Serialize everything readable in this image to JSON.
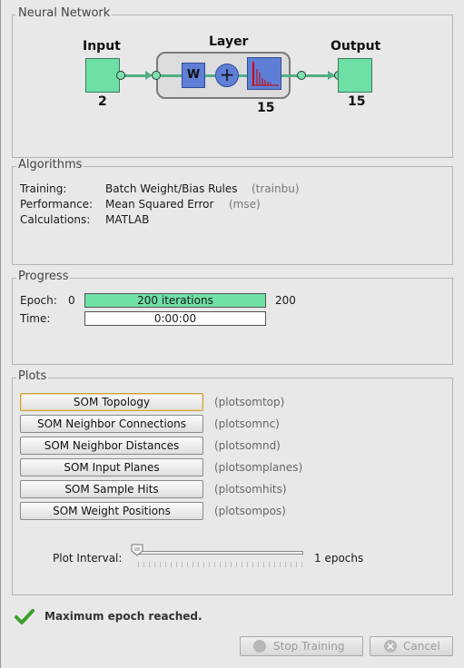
{
  "network": {
    "title": "Neural Network",
    "input_label": "Input",
    "input_size": "2",
    "layer_label": "Layer",
    "layer_size": "15",
    "weight_symbol": "W",
    "sum_symbol": "+",
    "output_label": "Output",
    "output_size": "15"
  },
  "algorithms": {
    "title": "Algorithms",
    "rows": [
      {
        "label": "Training:",
        "value": "Batch Weight/Bias Rules",
        "code": "(trainbu)"
      },
      {
        "label": "Performance:",
        "value": "Mean Squared Error",
        "code": "(mse)"
      },
      {
        "label": "Calculations:",
        "value": "MATLAB",
        "code": ""
      }
    ]
  },
  "progress": {
    "title": "Progress",
    "epoch_label": "Epoch:",
    "epoch_start": "0",
    "epoch_bar_text": "200 iterations",
    "epoch_end": "200",
    "epoch_fraction": 1.0,
    "time_label": "Time:",
    "time_text": "0:00:00"
  },
  "plots": {
    "title": "Plots",
    "buttons": [
      {
        "label": "SOM Topology",
        "code": "(plotsomtop)"
      },
      {
        "label": "SOM Neighbor Connections",
        "code": "(plotsomnc)"
      },
      {
        "label": "SOM Neighbor Distances",
        "code": "(plotsomnd)"
      },
      {
        "label": "SOM Input Planes",
        "code": "(plotsomplanes)"
      },
      {
        "label": "SOM Sample Hits",
        "code": "(plotsomhits)"
      },
      {
        "label": "SOM Weight Positions",
        "code": "(plotsompos)"
      }
    ],
    "interval_label": "Plot Interval:",
    "interval_value": "1 epochs",
    "interval_slider_value": 1
  },
  "status": {
    "message": "Maximum epoch reached.",
    "icon": "checkmark-icon",
    "color": "#3aa02a"
  },
  "footer": {
    "stop_label": "Stop Training",
    "cancel_label": "Cancel"
  },
  "colors": {
    "accent_green": "#6ee0a6",
    "layer_blue": "#5f7fd6"
  }
}
